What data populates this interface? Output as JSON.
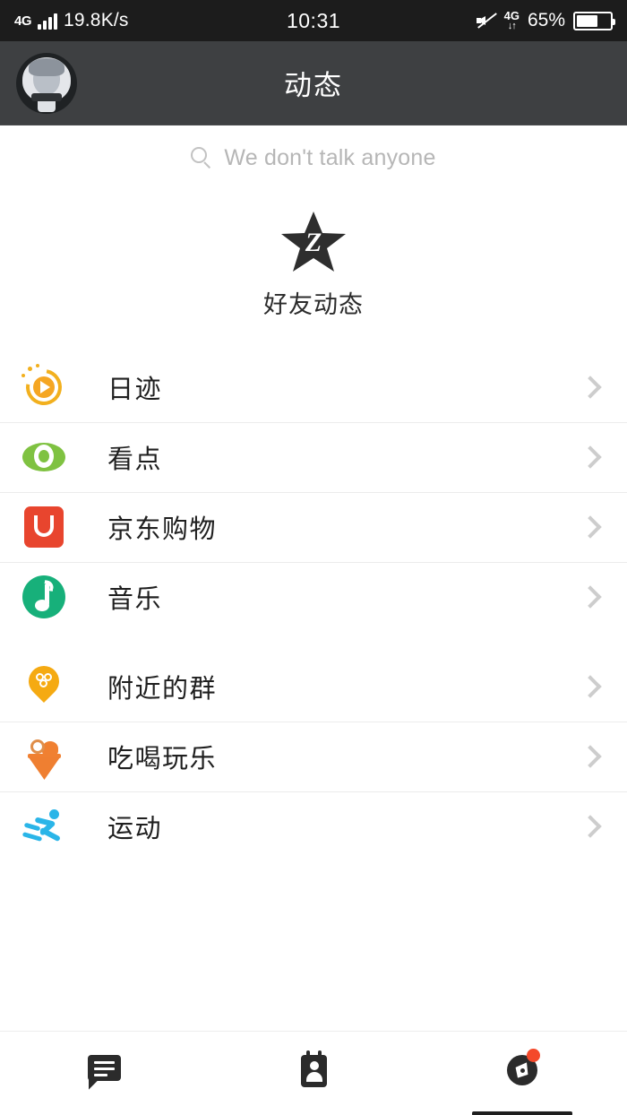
{
  "status_bar": {
    "network_type": "4G",
    "signal_icon": "signal-bars-icon",
    "speed": "19.8K/s",
    "time": "10:31",
    "mute_icon": "mute-icon",
    "data_label": "4G",
    "data_arrows": "↓↑",
    "battery_percent": "65%",
    "battery_icon": "battery-icon"
  },
  "title_bar": {
    "avatar_icon": "avatar",
    "title": "动态"
  },
  "search": {
    "icon": "search-icon",
    "placeholder": "We don't talk anyone",
    "value": ""
  },
  "featured": {
    "icon": "qzone-star-icon",
    "icon_glyph": "Z",
    "label": "好友动态"
  },
  "list_groups": [
    {
      "rows": [
        {
          "icon": "rili-icon",
          "label": "日迹",
          "color": "#f5a623",
          "chevron": "chevron-right-icon"
        },
        {
          "icon": "kandian-eye-icon",
          "label": "看点",
          "color": "#7fc241",
          "chevron": "chevron-right-icon"
        },
        {
          "icon": "jd-shopping-icon",
          "label": "京东购物",
          "color": "#e8452e",
          "chevron": "chevron-right-icon"
        },
        {
          "icon": "music-icon",
          "label": "音乐",
          "color": "#17b07a",
          "chevron": "chevron-right-icon"
        }
      ]
    },
    {
      "rows": [
        {
          "icon": "nearby-group-pin-icon",
          "label": "附近的群",
          "color": "#f5aa12",
          "chevron": "chevron-right-icon"
        },
        {
          "icon": "food-fun-icon",
          "label": "吃喝玩乐",
          "color": "#ef7f31",
          "chevron": "chevron-right-icon"
        },
        {
          "icon": "sport-runner-icon",
          "label": "运动",
          "color": "#2ab5e8",
          "chevron": "chevron-right-icon"
        }
      ]
    }
  ],
  "bottom_nav": {
    "items": [
      {
        "icon": "message-icon",
        "active": false,
        "badge": ""
      },
      {
        "icon": "contacts-icon",
        "active": false,
        "badge": ""
      },
      {
        "icon": "compass-discover-icon",
        "active": true,
        "badge": "dot"
      }
    ]
  },
  "colors": {
    "status_bar_bg": "#1c1c1c",
    "title_bar_bg": "#3e4042",
    "page_bg": "#ffffff",
    "divider": "#ececec",
    "text_primary": "#1f1f1f",
    "text_placeholder": "#b6b6b6",
    "badge_red": "#f4492a"
  }
}
